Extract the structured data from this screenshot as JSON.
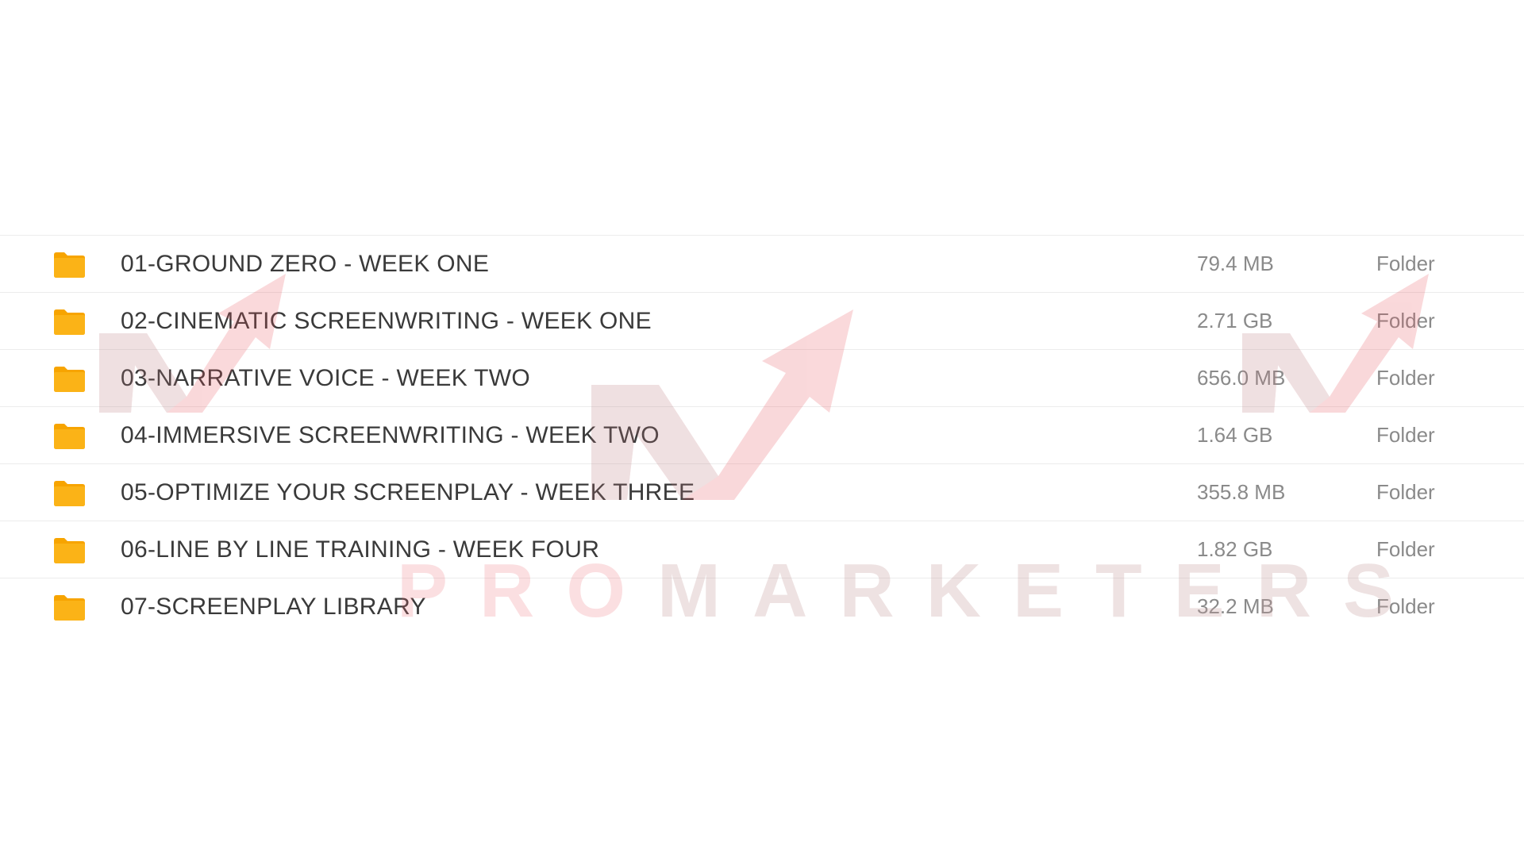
{
  "colors": {
    "folder": "#FBB317",
    "folder_tab": "#F7A400",
    "row_divider": "#ececec",
    "name_text": "#3a3a3a",
    "meta_text": "#8a8a8a",
    "watermark_red": "#EB6E78"
  },
  "files": [
    {
      "name": "01-GROUND ZERO - WEEK ONE",
      "size": "79.4 MB",
      "kind": "Folder",
      "icon": "folder-icon"
    },
    {
      "name": "02-CINEMATIC SCREENWRITING - WEEK ONE",
      "size": "2.71 GB",
      "kind": "Folder",
      "icon": "folder-icon"
    },
    {
      "name": "03-NARRATIVE VOICE - WEEK TWO",
      "size": "656.0 MB",
      "kind": "Folder",
      "icon": "folder-icon"
    },
    {
      "name": "04-IMMERSIVE SCREENWRITING - WEEK TWO",
      "size": "1.64 GB",
      "kind": "Folder",
      "icon": "folder-icon"
    },
    {
      "name": "05-OPTIMIZE YOUR SCREENPLAY - WEEK THREE",
      "size": "355.8 MB",
      "kind": "Folder",
      "icon": "folder-icon"
    },
    {
      "name": "06-LINE BY LINE TRAINING - WEEK FOUR",
      "size": "1.82 GB",
      "kind": "Folder",
      "icon": "folder-icon"
    },
    {
      "name": "07-SCREENPLAY LIBRARY",
      "size": "32.2 MB",
      "kind": "Folder",
      "icon": "folder-icon"
    }
  ],
  "watermark": {
    "brand_prefix": "PRO",
    "brand_suffix": "MARKETERS",
    "icon": "promarketers-logo-icon"
  }
}
